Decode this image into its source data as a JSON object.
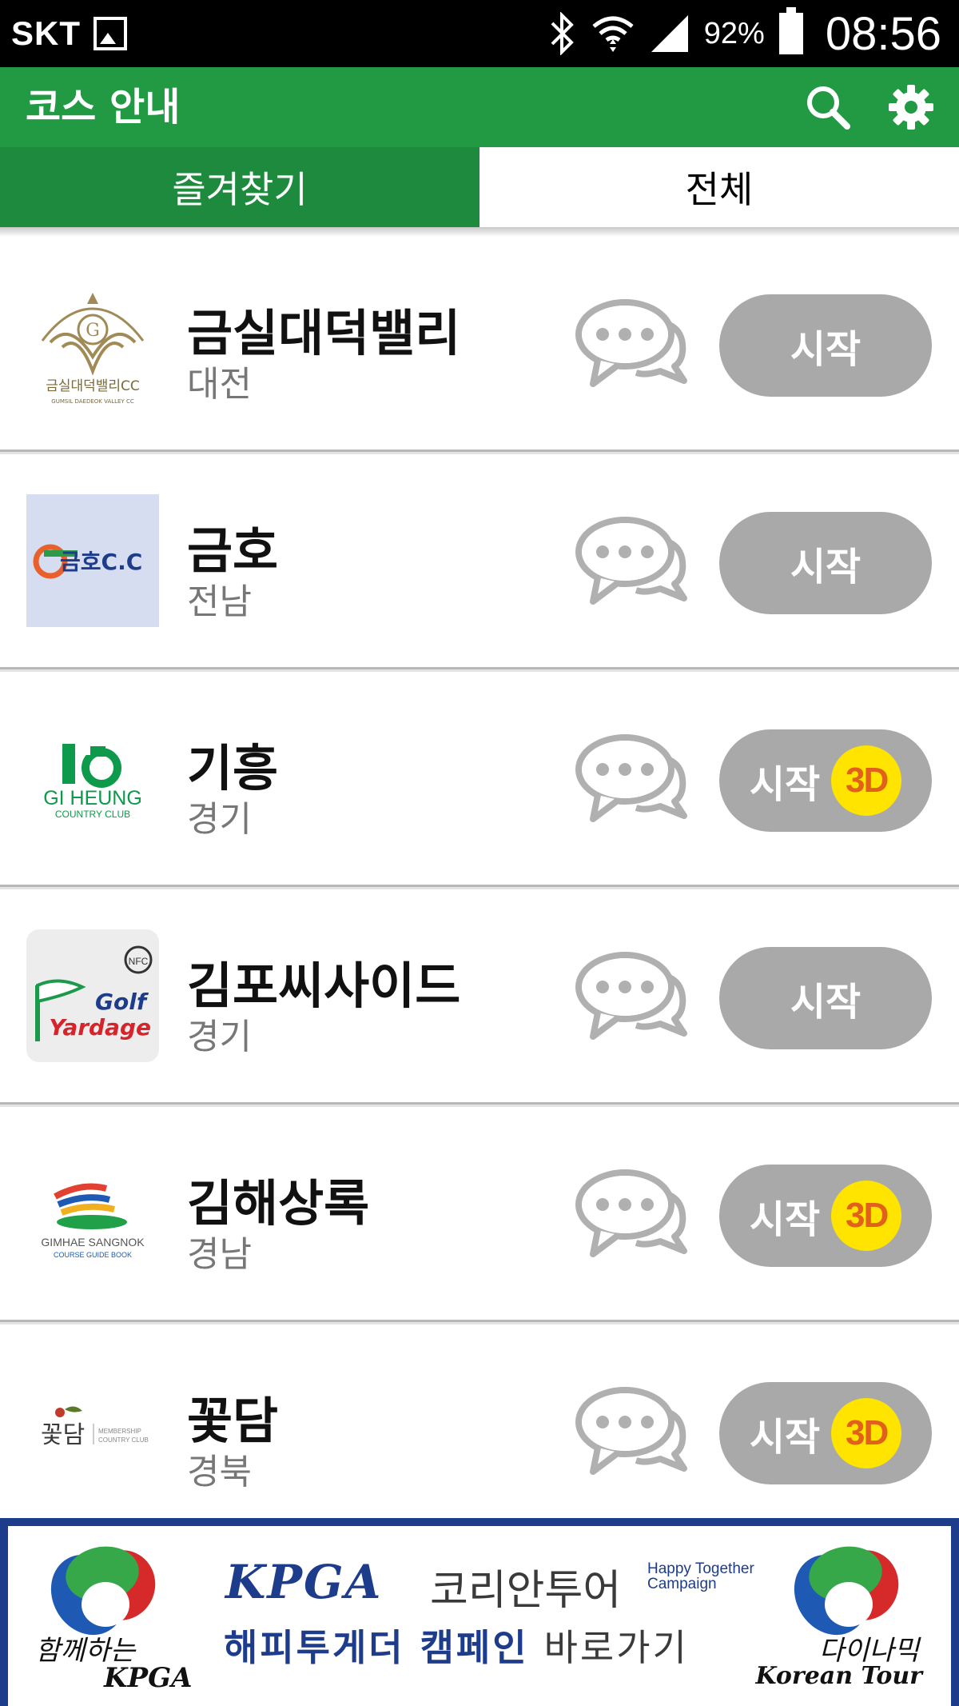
{
  "status_bar": {
    "carrier": "SKT",
    "battery": "92%",
    "time": "08:56",
    "icons": [
      "image-icon",
      "bluetooth-icon",
      "wifi-icon",
      "signal-icon",
      "battery-icon"
    ]
  },
  "header": {
    "title": "코스 안내",
    "actions": [
      "search-icon",
      "gear-icon"
    ]
  },
  "tabs": [
    {
      "label": "즐겨찾기",
      "active": true
    },
    {
      "label": "전체",
      "active": false
    }
  ],
  "courses": [
    {
      "name": "금실대덕밸리",
      "region": "대전",
      "button": "시작",
      "has_3d": false,
      "logo_text": "금실대덕밸리CC",
      "logo_sub": "GUMSIL DAEDEOK VALLEY CC"
    },
    {
      "name": "금호",
      "region": "전남",
      "button": "시작",
      "has_3d": false,
      "logo_text": "금호C.C"
    },
    {
      "name": "기흥",
      "region": "경기",
      "button": "시작",
      "has_3d": true,
      "badge": "3D",
      "logo_text": "GI HEUNG",
      "logo_sub": "COUNTRY CLUB"
    },
    {
      "name": "김포씨사이드",
      "region": "경기",
      "button": "시작",
      "has_3d": false,
      "logo_text": "Golf",
      "logo_sub": "Yardage"
    },
    {
      "name": "김해상록",
      "region": "경남",
      "button": "시작",
      "has_3d": true,
      "badge": "3D",
      "logo_text": "GIMHAE SANGNOK",
      "logo_sub": "COURSE GUIDE BOOK"
    },
    {
      "name": "꽃담",
      "region": "경북",
      "button": "시작",
      "has_3d": true,
      "badge": "3D",
      "logo_text": "꽃담",
      "logo_sub": "MEMBERSHIP COUNTRY CLUB"
    }
  ],
  "banner": {
    "kpga": "KPGA",
    "korean_tour": "코리안투어",
    "happy_line1": "Happy Together",
    "happy_line2": "Campaign",
    "line2_bold": "해피투게더 캠페인",
    "line2_normal": "바로가기",
    "left_caption": "함께하는",
    "left_caption2": "KPGA",
    "right_caption": "다이나믹",
    "right_caption2": "Korean Tour"
  },
  "colors": {
    "header_green": "#229a44",
    "tab_active_green": "#1d8a3d",
    "button_gray": "#a9a9a9",
    "badge_yellow": "#ffe400",
    "badge_text_orange": "#e0601c",
    "banner_navy": "#1e3c8c"
  }
}
